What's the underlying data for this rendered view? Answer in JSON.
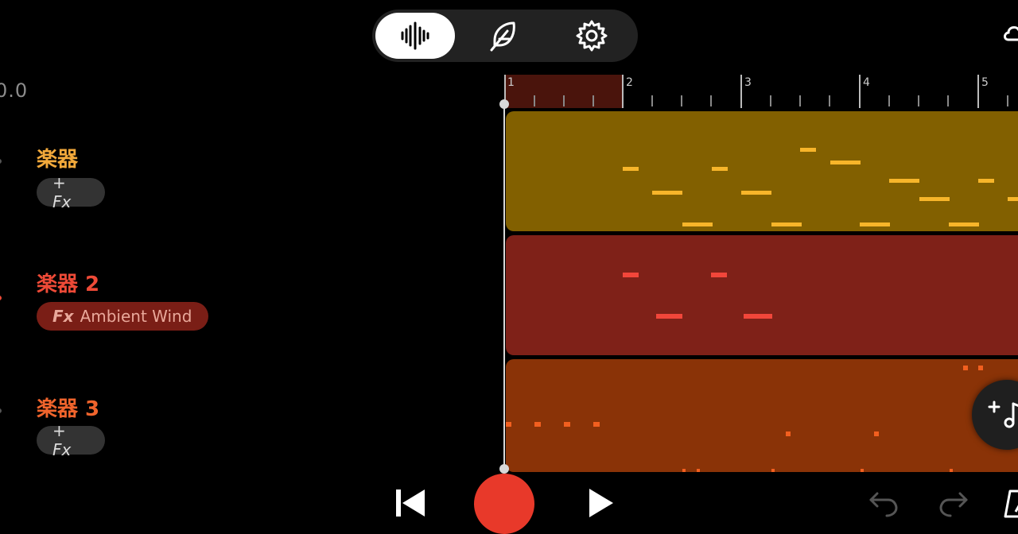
{
  "top_toolbar": {
    "modes": [
      {
        "name": "waveform-icon",
        "active": true
      },
      {
        "name": "feather-icon",
        "active": false
      },
      {
        "name": "gear-icon",
        "active": false
      }
    ]
  },
  "header": {
    "tempo_fragment": "0.0"
  },
  "tracks": [
    {
      "title": "楽器",
      "fx_label": "+ Fx",
      "fx_prefix": "",
      "fx_name": "",
      "title_color": "#f2a93b"
    },
    {
      "title": "楽器 2",
      "fx_label": "",
      "fx_prefix": "Fx",
      "fx_name": "Ambient Wind",
      "title_color": "#ee4a37"
    },
    {
      "title": "楽器 3",
      "fx_label": "+ Fx",
      "fx_prefix": "",
      "fx_name": "",
      "title_color": "#f0642c"
    }
  ],
  "ruler": {
    "bar_numbers": [
      "1",
      "2",
      "3",
      "4",
      "5"
    ]
  },
  "colors": {
    "lane1_bg": "#826000",
    "lane1_note": "#f7b52a",
    "lane2_bg": "#7f2118",
    "lane2_note": "#f2463a",
    "lane3_bg": "#8a3307",
    "lane3_note": "#f25f1f",
    "record": "#e8392a"
  },
  "transport": {
    "icons": [
      "skip-back-icon",
      "record-button",
      "play-icon"
    ],
    "right_icons": [
      "undo-icon",
      "redo-icon",
      "metronome-icon"
    ]
  }
}
